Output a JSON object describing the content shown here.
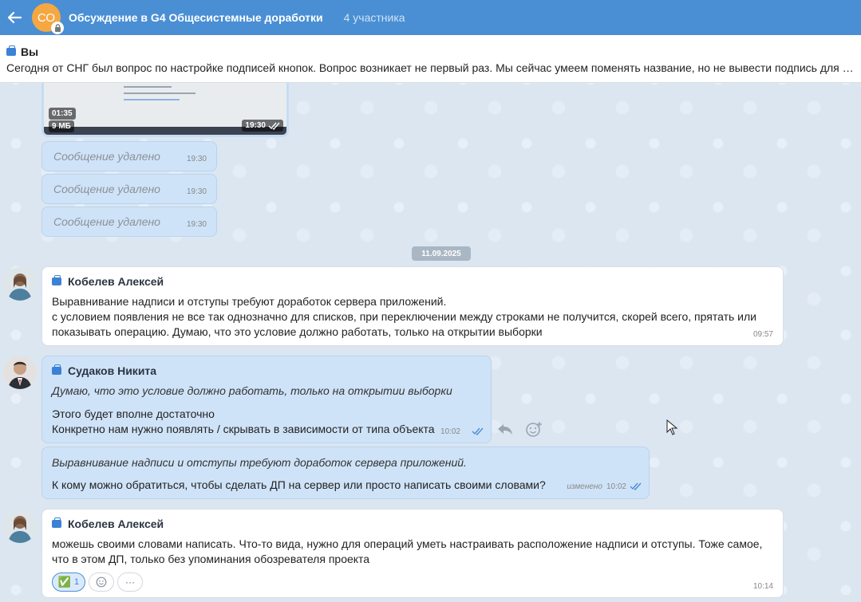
{
  "header": {
    "avatar_initials": "СО",
    "title": "Обсуждение в G4 Общесистемные доработки",
    "participants": "4 участника"
  },
  "pinned": {
    "author": "Вы",
    "text": "Сегодня от СНГ был вопрос по настройке подписей кнопок. Вопрос возникает не первый раз. Мы сейчас умеем поменять название, но не вывести подпись для операции"
  },
  "video": {
    "duration": "01:35",
    "size": "9 МБ",
    "time": "19:30"
  },
  "deleted": [
    {
      "text": "Сообщение удалено",
      "time": "19:30"
    },
    {
      "text": "Сообщение удалено",
      "time": "19:30"
    },
    {
      "text": "Сообщение удалено",
      "time": "19:30"
    }
  ],
  "date_divider": "11.09.2025",
  "messages": [
    {
      "author": "Кобелев Алексей",
      "lines": [
        "Выравнивание надписи и отступы требуют доработок сервера приложений.",
        "с условием появления не все так однозначно для  списков, при переключении между строками не получится, скорей всего,  прятать или",
        "показывать операцию. Думаю, что это условие должно работать, только на открытии выборки"
      ],
      "time": "09:57"
    },
    {
      "author": "Судаков Никита",
      "quote": "Думаю, что это условие должно работать, только на открытии выборки",
      "lines": [
        "Этого будет вполне достаточно",
        "Конкретно нам нужно появлять / скрывать в зависимости от типа объекта"
      ],
      "time": "10:02"
    },
    {
      "quote": "Выравнивание надписи и отступы требуют доработок сервера приложений.",
      "lines": [
        "К кому можно обратиться, чтобы сделать ДП на сервер или просто написать своими словами?"
      ],
      "edited": "изменено",
      "time": "10:02"
    },
    {
      "author": "Кобелев Алексей",
      "lines": [
        "можешь своими словами написать. Что-то вида, нужно для операций уметь настраивать расположение надписи и отступы. Тоже самое,",
        "что в этом ДП, только без упоминания обозревателя проекта"
      ],
      "reaction_emoji": "✅",
      "reaction_count": "1",
      "more": "···",
      "time": "10:14"
    }
  ],
  "colors": {
    "header": "#4a8fd4",
    "outgoing": "#cfe3f8",
    "incoming": "#ffffff",
    "accent": "#3b82d6"
  }
}
